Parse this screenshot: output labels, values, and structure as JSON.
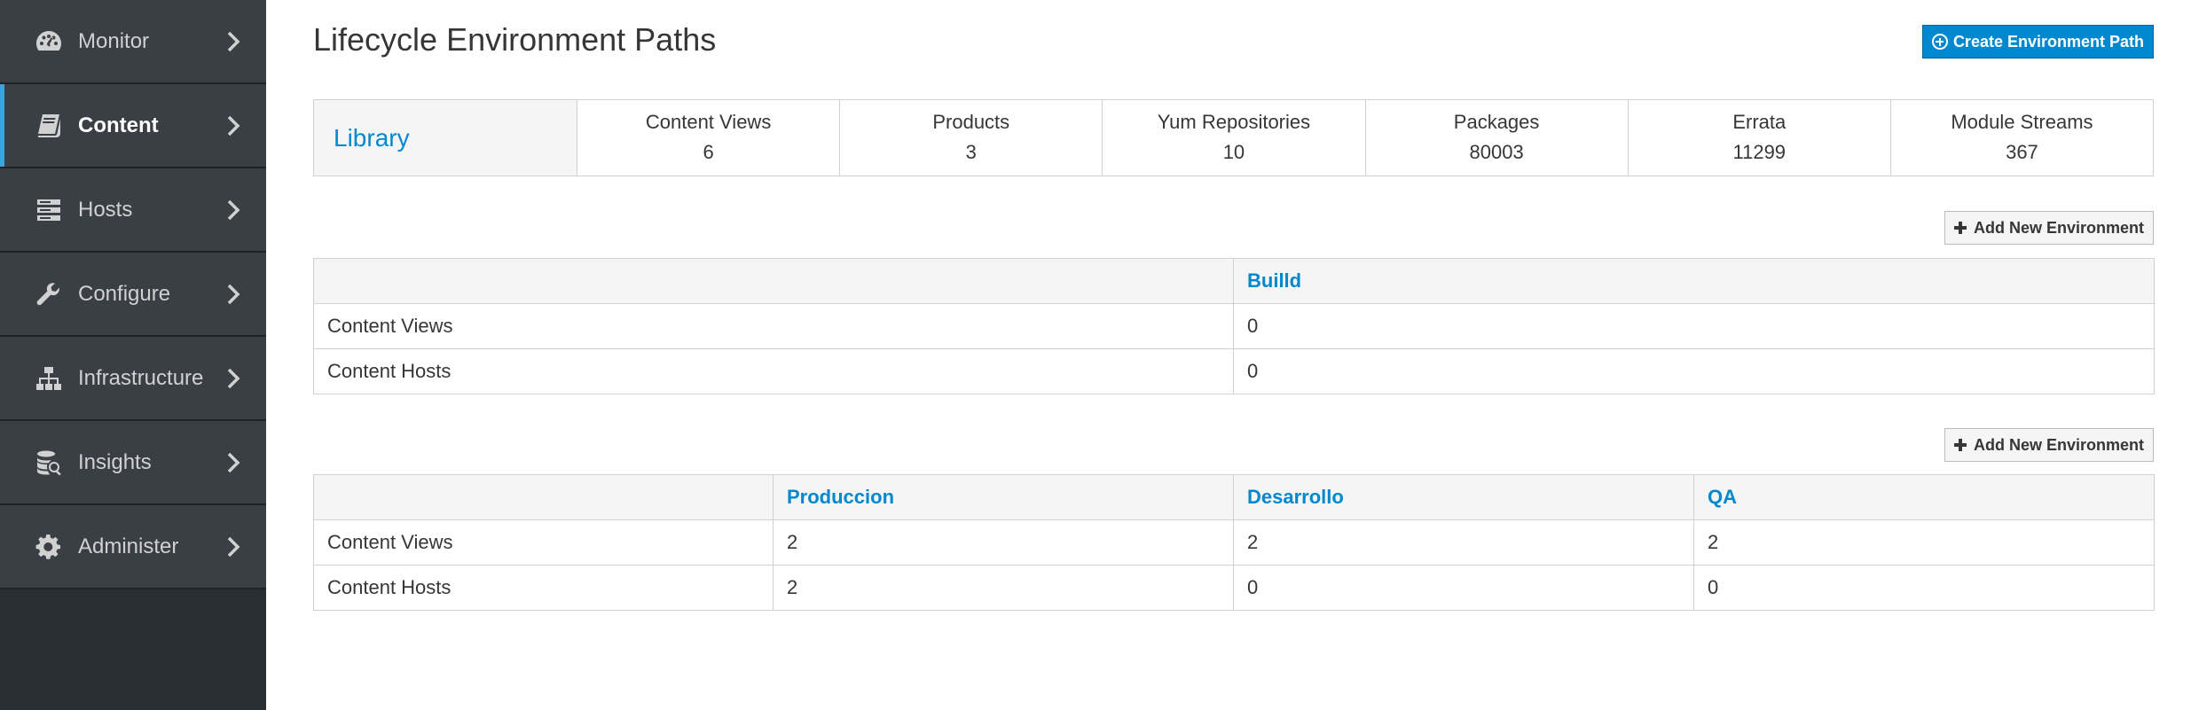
{
  "sidebar": {
    "items": [
      {
        "label": "Monitor",
        "icon": "dashboard-icon"
      },
      {
        "label": "Content",
        "icon": "book-icon"
      },
      {
        "label": "Hosts",
        "icon": "server-icon"
      },
      {
        "label": "Configure",
        "icon": "wrench-icon"
      },
      {
        "label": "Infrastructure",
        "icon": "sitemap-icon"
      },
      {
        "label": "Insights",
        "icon": "database-search-icon"
      },
      {
        "label": "Administer",
        "icon": "gear-icon"
      }
    ]
  },
  "page": {
    "title": "Lifecycle Environment Paths",
    "create_button": "Create Environment Path",
    "add_env_button": "Add New Environment"
  },
  "library": {
    "name": "Library",
    "stats": [
      {
        "label": "Content Views",
        "value": "6"
      },
      {
        "label": "Products",
        "value": "3"
      },
      {
        "label": "Yum Repositories",
        "value": "10"
      },
      {
        "label": "Packages",
        "value": "80003"
      },
      {
        "label": "Errata",
        "value": "11299"
      },
      {
        "label": "Module Streams",
        "value": "367"
      }
    ]
  },
  "path1": {
    "environments": [
      "Builld"
    ],
    "rows": [
      {
        "label": "Content Views",
        "values": [
          "0"
        ]
      },
      {
        "label": "Content Hosts",
        "values": [
          "0"
        ]
      }
    ]
  },
  "path2": {
    "environments": [
      "Produccion",
      "Desarrollo",
      "QA"
    ],
    "rows": [
      {
        "label": "Content Views",
        "values": [
          "2",
          "2",
          "2"
        ]
      },
      {
        "label": "Content Hosts",
        "values": [
          "2",
          "0",
          "0"
        ]
      }
    ]
  },
  "colors": {
    "sidebar_bg": "#393f44",
    "active_accent": "#39a5dc",
    "link": "#0088ce",
    "primary_button": "#0088ce"
  }
}
